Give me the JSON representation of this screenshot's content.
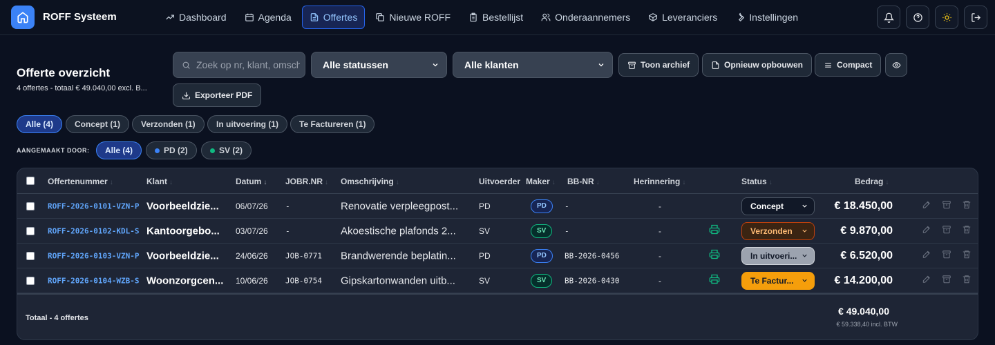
{
  "app": {
    "title": "ROFF Systeem"
  },
  "nav": [
    {
      "label": "Dashboard",
      "icon": "trending-up-icon",
      "active": false
    },
    {
      "label": "Agenda",
      "icon": "calendar-icon",
      "active": false
    },
    {
      "label": "Offertes",
      "icon": "file-text-icon",
      "active": true
    },
    {
      "label": "Nieuwe ROFF",
      "icon": "copy-icon",
      "active": false
    },
    {
      "label": "Bestellijst",
      "icon": "clipboard-icon",
      "active": false
    },
    {
      "label": "Onderaannemers",
      "icon": "users-icon",
      "active": false
    },
    {
      "label": "Leveranciers",
      "icon": "box-icon",
      "active": false
    },
    {
      "label": "Instellingen",
      "icon": "wrench-icon",
      "active": false
    }
  ],
  "page": {
    "title": "Offerte overzicht",
    "subtitle": "4 offertes - totaal € 49.040,00 excl. B..."
  },
  "toolbar": {
    "search_placeholder": "Zoek op nr, klant, omschr",
    "status_select": "Alle statussen",
    "client_select": "Alle klanten",
    "archive": "Toon archief",
    "rebuild": "Opnieuw opbouwen",
    "compact": "Compact",
    "export": "Exporteer PDF"
  },
  "filters": [
    {
      "label": "Alle (4)",
      "active": true
    },
    {
      "label": "Concept (1)",
      "active": false
    },
    {
      "label": "Verzonden (1)",
      "active": false
    },
    {
      "label": "In uitvoering (1)",
      "active": false
    },
    {
      "label": "Te Factureren (1)",
      "active": false
    }
  ],
  "made_by": {
    "label": "AANGEMAAKT DOOR:",
    "options": [
      {
        "label": "Alle (4)",
        "active": true,
        "dot": ""
      },
      {
        "label": "PD (2)",
        "active": false,
        "dot": "#3b82f6"
      },
      {
        "label": "SV (2)",
        "active": false,
        "dot": "#10b981"
      }
    ]
  },
  "table": {
    "headers": {
      "nr": "Offertenummer",
      "klant": "Klant",
      "datum": "Datum",
      "jobr": "JOBR.NR",
      "oms": "Omschrijving",
      "uitv": "Uitvoerder",
      "maker": "Maker",
      "bb": "BB-NR",
      "herinnering": "Herinnering",
      "status": "Status",
      "bedrag": "Bedrag"
    },
    "rows": [
      {
        "nr": "ROFF-2026-0101-VZN-P",
        "klant": "Voorbeeldzie...",
        "datum": "06/07/26",
        "jobr": "-",
        "oms": "Renovatie verpleegpost...",
        "uitv": "PD",
        "maker": "PD",
        "bb": "-",
        "herinnering": "-",
        "print": false,
        "status": "Concept",
        "bedrag": "€ 18.450,00"
      },
      {
        "nr": "ROFF-2026-0102-KDL-S",
        "klant": "Kantoorgebo...",
        "datum": "03/07/26",
        "jobr": "-",
        "oms": "Akoestische plafonds 2...",
        "uitv": "SV",
        "maker": "SV",
        "bb": "-",
        "herinnering": "-",
        "print": true,
        "status": "Verzonden",
        "bedrag": "€ 9.870,00"
      },
      {
        "nr": "ROFF-2026-0103-VZN-P",
        "klant": "Voorbeeldzie...",
        "datum": "24/06/26",
        "jobr": "JOB-0771",
        "oms": "Brandwerende beplatin...",
        "uitv": "PD",
        "maker": "PD",
        "bb": "BB-2026-0456",
        "herinnering": "-",
        "print": true,
        "status": "In uitvoeri...",
        "bedrag": "€ 6.520,00"
      },
      {
        "nr": "ROFF-2026-0104-WZB-S",
        "klant": "Woonzorgcen...",
        "datum": "10/06/26",
        "jobr": "JOB-0754",
        "oms": "Gipskartonwanden uitb...",
        "uitv": "SV",
        "maker": "SV",
        "bb": "BB-2026-0430",
        "herinnering": "-",
        "print": true,
        "status": "Te Factur...",
        "bedrag": "€ 14.200,00"
      }
    ],
    "footer": {
      "label": "Totaal - 4 offertes",
      "total": "€ 49.040,00",
      "incl": "€ 59.338,40 incl. BTW"
    }
  },
  "status_colors": {
    "Concept": {
      "bg": "#111827",
      "fg": "#ffffff",
      "border": "#4b5563"
    },
    "Verzonden": {
      "bg": "#3b2412",
      "fg": "#fdba74",
      "border": "#c2410c"
    },
    "In uitvoeri...": {
      "bg": "#9ca3af",
      "fg": "#111827",
      "border": "#d1d5db"
    },
    "Te Factur...": {
      "bg": "#f59e0b",
      "fg": "#111827",
      "border": "#f59e0b"
    }
  }
}
